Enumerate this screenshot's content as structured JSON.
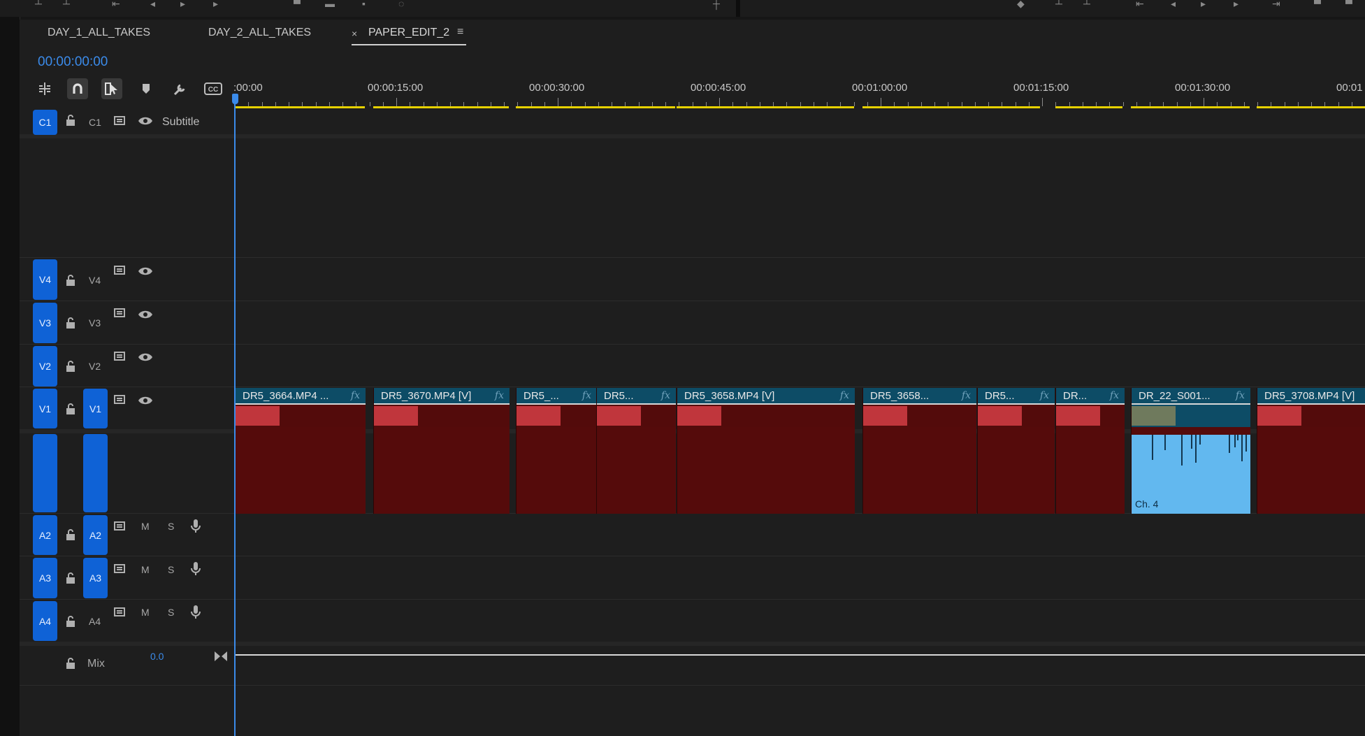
{
  "tabs": [
    {
      "label": "DAY_1_ALL_TAKES"
    },
    {
      "label": "DAY_2_ALL_TAKES"
    },
    {
      "label": "PAPER_EDIT_2"
    }
  ],
  "tab_close_glyph": "×",
  "tab_menu_glyph": "≡",
  "timecode": "00:00:00:00",
  "tools": [
    {
      "name": "insert-nest-icon"
    },
    {
      "name": "snap-magnet-icon"
    },
    {
      "name": "linked-selection-icon"
    },
    {
      "name": "add-marker-icon"
    },
    {
      "name": "wrench-settings-icon"
    },
    {
      "name": "captions-icon"
    }
  ],
  "ruler": {
    "labels": [
      ":00:00",
      "00:00:15:00",
      "00:00:30:00",
      "00:00:45:00",
      "00:01:00:00",
      "00:01:15:00",
      "00:01:30:00",
      "00:01"
    ]
  },
  "tracks": {
    "caption": {
      "target": "C1",
      "name": "C1",
      "label": "Subtitle"
    },
    "video": [
      {
        "target": "V4",
        "name": "V4"
      },
      {
        "target": "V3",
        "name": "V3"
      },
      {
        "target": "V2",
        "name": "V2"
      },
      {
        "target": "V1",
        "source": "V1"
      }
    ],
    "audio": [
      {
        "target": "A2",
        "source": "A2",
        "mute": "M",
        "solo": "S"
      },
      {
        "target": "A3",
        "source": "A3",
        "mute": "M",
        "solo": "S"
      },
      {
        "target": "A4",
        "name": "A4",
        "mute": "M",
        "solo": "S"
      }
    ],
    "mix": {
      "label": "Mix",
      "value": "0.0"
    }
  },
  "clips": [
    {
      "name": "DR5_3664.MP4 ...",
      "fx": "fx"
    },
    {
      "name": "DR5_3670.MP4 [V]",
      "fx": "fx"
    },
    {
      "name": "DR5_...",
      "fx": "fx"
    },
    {
      "name": "DR5...",
      "fx": "fx"
    },
    {
      "name": "DR5_3658.MP4 [V]",
      "fx": "fx"
    },
    {
      "name": "DR5_3658...",
      "fx": "fx"
    },
    {
      "name": "DR5...",
      "fx": "fx"
    },
    {
      "name": "DR...",
      "fx": "fx"
    },
    {
      "name": "DR_22_S001...",
      "fx": "fx",
      "channel_label": "Ch. 4"
    },
    {
      "name": "DR5_3708.MP4 [V]",
      "fx": ""
    }
  ],
  "colors": {
    "accent": "#0f62d6",
    "timecode": "#3b8bea",
    "clip_video_header": "#0d4c66",
    "clip_body": "#550b0b",
    "clip_audio_selected": "#62b8ef",
    "work_area": "#e6d100"
  }
}
